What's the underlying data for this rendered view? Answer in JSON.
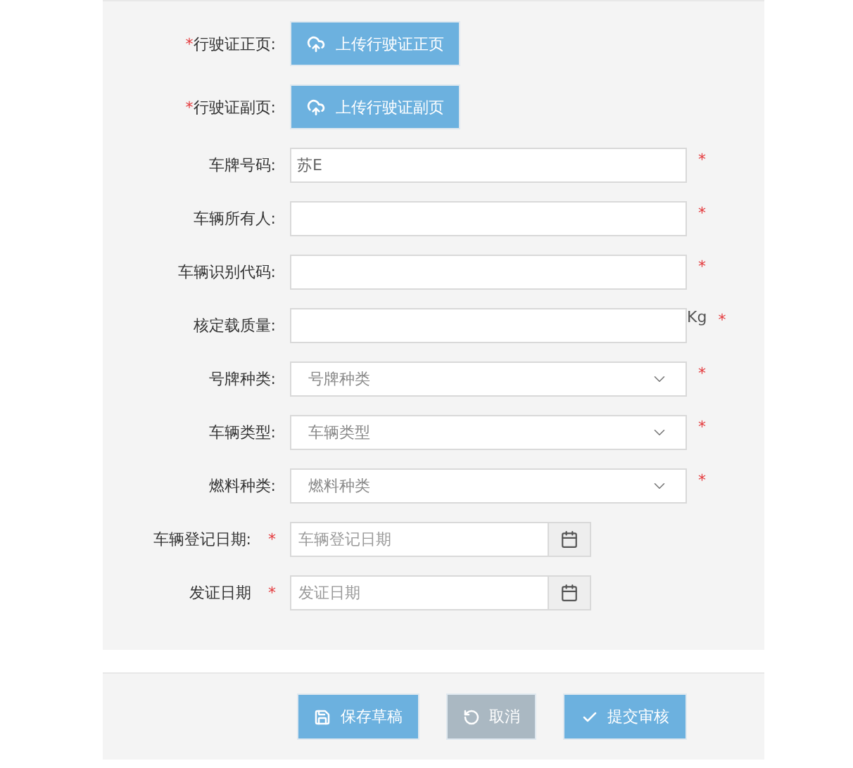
{
  "form": {
    "fields": [
      {
        "kind": "upload",
        "label": "行驶证正页:",
        "required_mark": "*",
        "button": "上传行驶证正页"
      },
      {
        "kind": "upload",
        "label": "行驶证副页:",
        "required_mark": "*",
        "button": "上传行驶证副页"
      },
      {
        "kind": "text",
        "label": "车牌号码:",
        "required_mark": "*",
        "value": "苏E"
      },
      {
        "kind": "text",
        "label": "车辆所有人:",
        "required_mark": "*"
      },
      {
        "kind": "text",
        "label": "车辆识别代码:",
        "required_mark": "*"
      },
      {
        "kind": "text",
        "label": "核定载质量:",
        "required_mark": "*",
        "unit": "Kg"
      },
      {
        "kind": "select",
        "label": "号牌种类:",
        "required_mark": "*",
        "placeholder": "号牌种类"
      },
      {
        "kind": "select",
        "label": "车辆类型:",
        "required_mark": "*",
        "placeholder": "车辆类型"
      },
      {
        "kind": "select",
        "label": "燃料种类:",
        "required_mark": "*",
        "placeholder": "燃料种类"
      },
      {
        "kind": "date",
        "label": "车辆登记日期:",
        "required_mark": "*",
        "placeholder": "车辆登记日期"
      },
      {
        "kind": "date",
        "label": "发证日期",
        "required_mark": "*",
        "placeholder": "发证日期"
      }
    ]
  },
  "actions": [
    {
      "kind": "save",
      "label": "保存草稿"
    },
    {
      "kind": "cancel",
      "label": "取消"
    },
    {
      "kind": "submit",
      "label": "提交审核"
    }
  ]
}
